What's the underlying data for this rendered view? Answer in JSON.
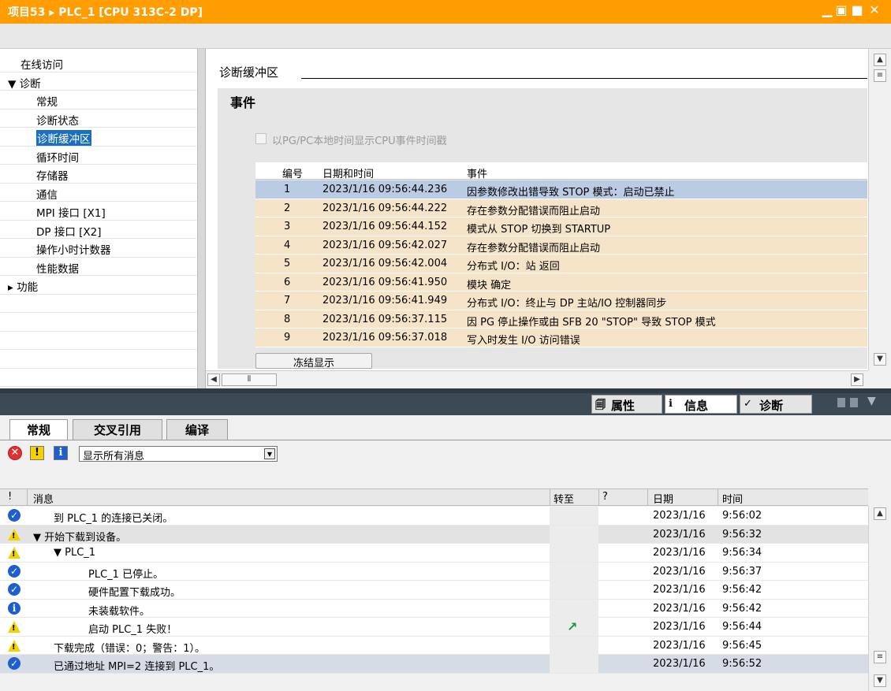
{
  "title_bar": {
    "title": "项目53 ▸ PLC_1 [CPU 313C-2 DP]"
  },
  "nav": {
    "items": [
      {
        "label": "在线访问",
        "indent": 0
      },
      {
        "label": "▼ 诊断",
        "indent": 0
      },
      {
        "label": "常规",
        "indent": 2
      },
      {
        "label": "诊断状态",
        "indent": 2
      },
      {
        "label": "诊断缓冲区",
        "indent": 2,
        "selected": true
      },
      {
        "label": "循环时间",
        "indent": 2
      },
      {
        "label": "存储器",
        "indent": 2
      },
      {
        "label": "通信",
        "indent": 2
      },
      {
        "label": "MPI 接口 [X1]",
        "indent": 2
      },
      {
        "label": "DP 接口 [X2]",
        "indent": 2
      },
      {
        "label": "操作小时计数器",
        "indent": 2
      },
      {
        "label": "性能数据",
        "indent": 2
      },
      {
        "label": "▸ 功能",
        "indent": 0
      }
    ]
  },
  "diag_buffer": {
    "section_title": "诊断缓冲区",
    "events_title": "事件",
    "checkbox_label": "以PG/PC本地时间显示CPU事件时间戳",
    "columns": {
      "no": "编号",
      "datetime": "日期和时间",
      "event": "事件"
    },
    "rows": [
      {
        "no": "1",
        "datetime": "2023/1/16 09:56:44.236",
        "event": "因参数修改出错导致 STOP 模式：启动已禁止"
      },
      {
        "no": "2",
        "datetime": "2023/1/16 09:56:44.222",
        "event": "存在参数分配错误而阻止启动"
      },
      {
        "no": "3",
        "datetime": "2023/1/16 09:56:44.152",
        "event": "模式从 STOP 切换到 STARTUP"
      },
      {
        "no": "4",
        "datetime": "2023/1/16 09:56:42.027",
        "event": "存在参数分配错误而阻止启动"
      },
      {
        "no": "5",
        "datetime": "2023/1/16 09:56:42.004",
        "event": "分布式 I/O：站 返回"
      },
      {
        "no": "6",
        "datetime": "2023/1/16 09:56:41.950",
        "event": "模块 确定"
      },
      {
        "no": "7",
        "datetime": "2023/1/16 09:56:41.949",
        "event": "分布式 I/O：终止与 DP 主站/IO 控制器同步"
      },
      {
        "no": "8",
        "datetime": "2023/1/16 09:56:37.115",
        "event": "因 PG 停止操作或由 SFB 20 \"STOP\" 导致 STOP 模式"
      },
      {
        "no": "9",
        "datetime": "2023/1/16 09:56:37.018",
        "event": "写入时发生 I/O 访问错误"
      }
    ],
    "freeze_button": "冻结显示"
  },
  "inspector_tabs": [
    {
      "label": "属性",
      "icon": "properties-icon"
    },
    {
      "label": "信息",
      "icon": "info-tab-icon",
      "active": true
    },
    {
      "label": "诊断",
      "icon": "diagnostics-icon"
    }
  ],
  "bottom_tabs": [
    {
      "label": "常规",
      "active": true
    },
    {
      "label": "交叉引用"
    },
    {
      "label": "编译"
    }
  ],
  "filter": {
    "selected": "显示所有消息"
  },
  "messages": {
    "columns": {
      "flag": "!",
      "message": "消息",
      "goto": "转至",
      "q": "?",
      "date": "日期",
      "time": "时间"
    },
    "rows": [
      {
        "type": "ok",
        "indent": 0,
        "text": "到 PLC_1 的连接已关闭。",
        "date": "2023/1/16",
        "time": "9:56:02",
        "bg": "white"
      },
      {
        "type": "warn",
        "indent": 1,
        "text": "▼  开始下载到设备。",
        "date": "2023/1/16",
        "time": "9:56:32",
        "bg": "alt"
      },
      {
        "type": "warn",
        "indent": 2,
        "text": "▼  PLC_1",
        "date": "2023/1/16",
        "time": "9:56:34",
        "bg": "white"
      },
      {
        "type": "ok",
        "indent": 3,
        "text": "PLC_1 已停止。",
        "date": "2023/1/16",
        "time": "9:56:37",
        "bg": "white"
      },
      {
        "type": "ok",
        "indent": 3,
        "text": "硬件配置下载成功。",
        "date": "2023/1/16",
        "time": "9:56:42",
        "bg": "white"
      },
      {
        "type": "info",
        "indent": 3,
        "text": "未装载软件。",
        "date": "2023/1/16",
        "time": "9:56:42",
        "bg": "white"
      },
      {
        "type": "warn",
        "indent": 3,
        "text": "启动 PLC_1 失败！",
        "date": "2023/1/16",
        "time": "9:56:44",
        "bg": "white",
        "goto": true
      },
      {
        "type": "warn",
        "indent": 0,
        "text": "下载完成（错误：0；警告：1）。",
        "date": "2023/1/16",
        "time": "9:56:45",
        "bg": "white"
      },
      {
        "type": "ok",
        "indent": 0,
        "text": "已通过地址 MPI=2 连接到 PLC_1。",
        "date": "2023/1/16",
        "time": "9:56:52",
        "bg": "sel"
      }
    ]
  },
  "colors": {
    "title_bar": "#ff9c00",
    "selected_row": "#b9cce4",
    "event_row": "#f6e4c8",
    "nav_selected": "#1a6fc2"
  }
}
